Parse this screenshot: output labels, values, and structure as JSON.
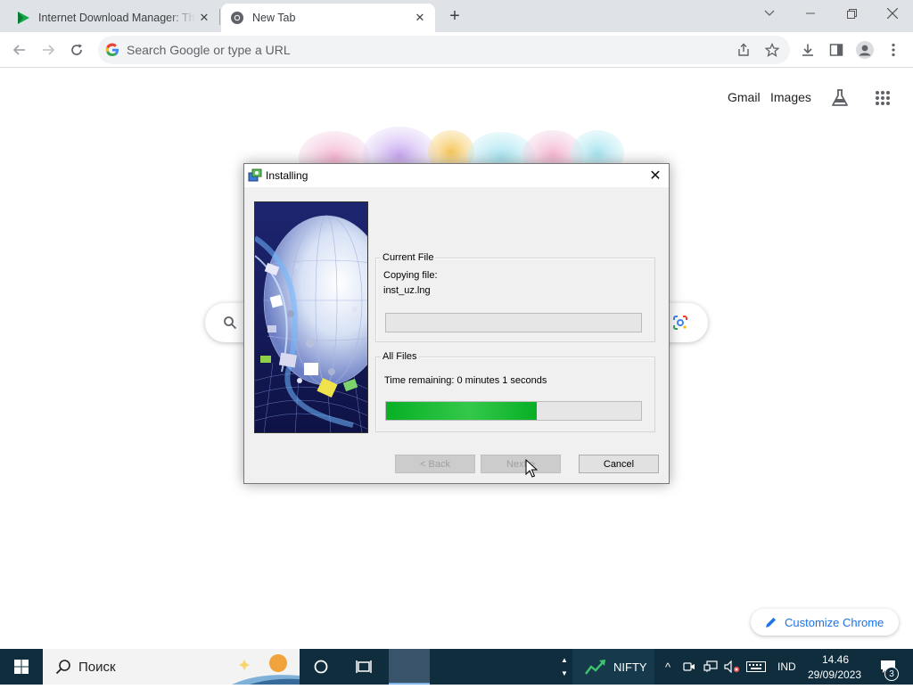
{
  "browser": {
    "tabs": [
      {
        "title": "Internet Download Manager: Th",
        "icon": "idm-play-icon",
        "active": false
      },
      {
        "title": "New Tab",
        "icon": "chrome-icon",
        "active": true
      }
    ],
    "omnibox_placeholder": "Search Google or type a URL"
  },
  "ntp": {
    "links": {
      "gmail": "Gmail",
      "images": "Images"
    },
    "customize_label": "Customize Chrome"
  },
  "dialog": {
    "title": "Installing",
    "current_file": {
      "group_label": "Current File",
      "status": "Copying file:",
      "filename": "inst_uz.lng",
      "progress": 0
    },
    "all_files": {
      "group_label": "All Files",
      "time_remaining": "Time remaining: 0 minutes 1 seconds",
      "progress": 0.59
    },
    "buttons": {
      "back": "< Back",
      "next": "Next >",
      "cancel": "Cancel"
    }
  },
  "taskbar": {
    "search_placeholder": "Поиск",
    "stock": {
      "label": "NIFTY"
    },
    "language": "IND",
    "time": "14.46",
    "date": "29/09/2023",
    "notifications": "3"
  },
  "colors": {
    "progress_green": "#06b025",
    "taskbar": "#0f2d3d",
    "accent_blue": "#1a73e8"
  }
}
